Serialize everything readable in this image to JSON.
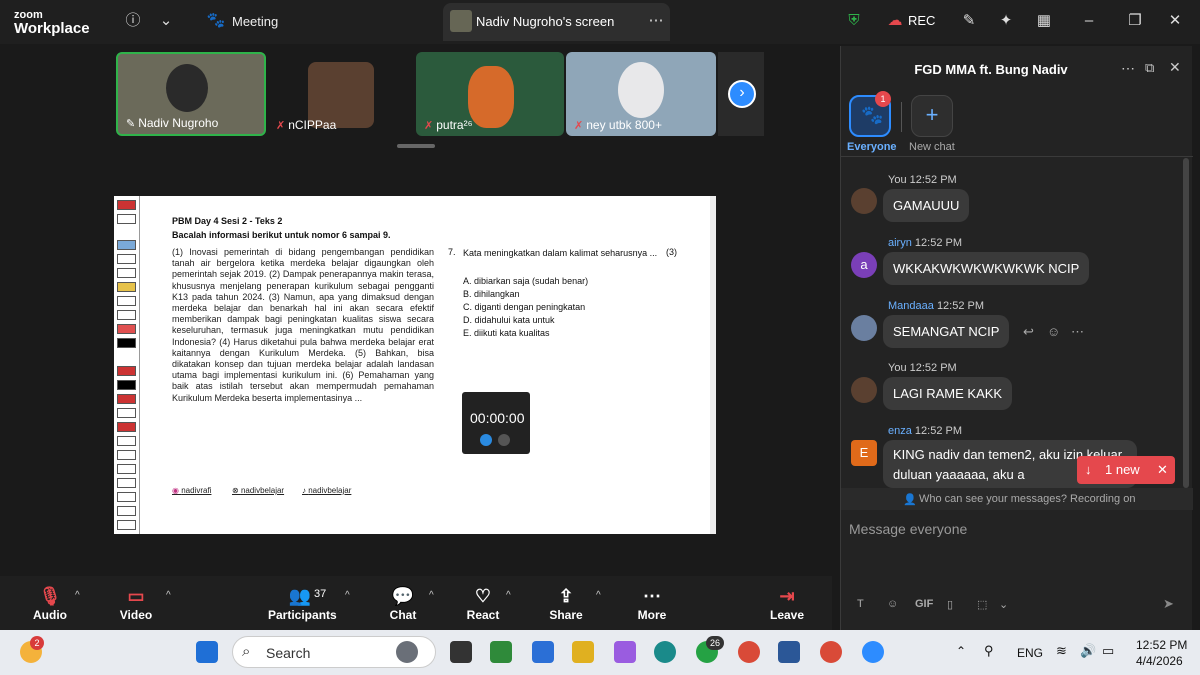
{
  "app": {
    "logo_line1": "zoom",
    "logo_line2": "Workplace",
    "meeting_label": "Meeting",
    "share_title": "Nadiv Nugroho's screen",
    "rec_label": "REC"
  },
  "participants": [
    {
      "name": "Nadiv Nugroho"
    },
    {
      "name": "nCIPPaa"
    },
    {
      "name": "putra²⁶"
    },
    {
      "name": "ney utbk 800+"
    }
  ],
  "document": {
    "title": "PBM Day 4 Sesi 2 - Teks 2",
    "subtitle": "Bacalah informasi berikut untuk nomor 6 sampai 9.",
    "paragraph": "(1) Inovasi pemerintah di bidang pengembangan pendidikan tanah air bergelora ketika merdeka belajar digaungkan oleh pemerintah sejak 2019. (2) Dampak penerapannya makin terasa, khususnya menjelang penerapan kurikulum sebagai pengganti K13 pada tahun 2024. (3) Namun, apa yang dimaksud dengan merdeka belajar dan benarkah hal ini akan secara efektif memberikan dampak bagi peningkatan kualitas siswa secara keseluruhan, termasuk juga meningkatkan mutu pendidikan Indonesia? (4) Harus diketahui pula bahwa merdeka belajar erat kaitannya dengan Kurikulum Merdeka. (5) Bahkan, bisa dikatakan konsep dan tujuan merdeka belajar adalah landasan utama bagi implementasi kurikulum ini. (6) Pemahaman yang baik atas istilah tersebut akan mempermudah pemahaman Kurikulum Merdeka beserta implementasinya ...",
    "question_number": "7.",
    "question_text": "Kata meningkatkan dalam kalimat seharusnya ...",
    "question_ref": "(3)",
    "options": [
      "A.  dibiarkan saja (sudah benar)",
      "B.  dihilangkan",
      "C.  diganti dengan peningkatan",
      "D.  didahului kata untuk",
      "E.  diikuti kata kualitas"
    ],
    "timer": "00:00:00",
    "socials": [
      "nadivrafi",
      "nadivbelajar",
      "nadivbelajar"
    ]
  },
  "toolbar": {
    "audio": "Audio",
    "video": "Video",
    "participants": "Participants",
    "participants_count": "37",
    "chat": "Chat",
    "react": "React",
    "share": "Share",
    "more": "More",
    "leave": "Leave"
  },
  "chat": {
    "title": "FGD MMA ft. Bung Nadiv",
    "everyone_label": "Everyone",
    "everyone_badge": "1",
    "new_chat_label": "New chat",
    "messages": [
      {
        "sender": "You",
        "time": "12:52 PM",
        "text": "GAMAUUU"
      },
      {
        "sender": "airyn",
        "time": "12:52 PM",
        "text": "WKKAKWKWKWKWKWK NCIP",
        "initial": "a"
      },
      {
        "sender": "Mandaaa",
        "time": "12:52 PM",
        "text": "SEMANGAT NCIP"
      },
      {
        "sender": "You",
        "time": "12:52 PM",
        "text": "LAGI RAME KAKK"
      },
      {
        "sender": "enza",
        "time": "12:52 PM",
        "text": "KING nadiv dan temen2, aku izin keluar duluan yaaaaaa, aku a",
        "initial": "E"
      }
    ],
    "new_pill": "1 new",
    "privacy": "Who can see your messages? Recording on",
    "input_placeholder": "Message everyone",
    "gif_label": "GIF"
  },
  "taskbar": {
    "weather_badge": "2",
    "search_placeholder": "Search",
    "whatsapp_badge": "26",
    "lang": "ENG",
    "time": "12:52 PM",
    "date": "4/4/2026"
  },
  "colors": {
    "accent": "#2d8cff",
    "danger": "#e5484d",
    "panel": "#232323"
  }
}
